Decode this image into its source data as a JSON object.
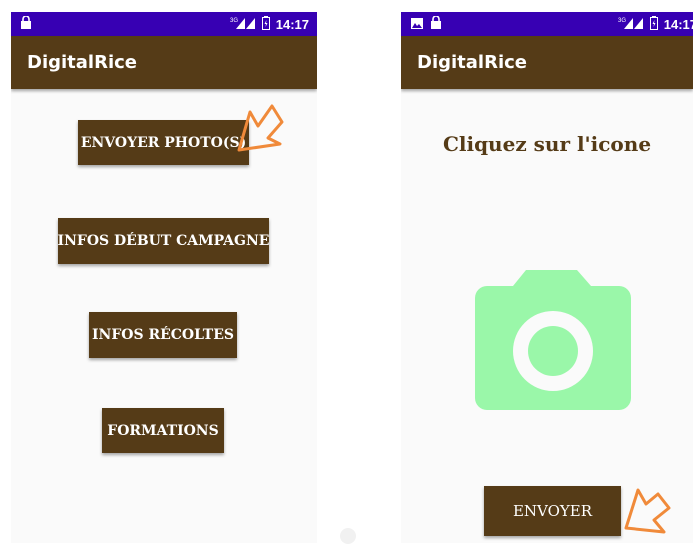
{
  "status": {
    "network": "3G",
    "time": "14:17"
  },
  "left": {
    "app_title": "DigitalRice",
    "buttons": {
      "send_photos": "ENVOYER  PHOTO(S)",
      "campaign_info": "INFOS DÉBUT CAMPAGNE",
      "harvest_info": "INFOS RÉCOLTES",
      "trainings": "FORMATIONS"
    }
  },
  "right": {
    "app_title": "DigitalRice",
    "heading": "Cliquez sur l'icone",
    "send_button": "ENVOYER"
  },
  "colors": {
    "status_bar": "#3700b3",
    "app_bar": "#553b17",
    "camera_icon": "#9af7a9",
    "arrow": "#f08a3a"
  },
  "icons": [
    "lock-icon",
    "signal-icon",
    "battery-icon",
    "image-icon",
    "camera-icon",
    "arrow-pointer-icon"
  ]
}
